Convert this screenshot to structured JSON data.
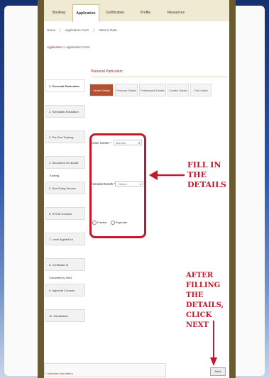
{
  "tabs": [
    "Booking",
    "Application",
    "Certification",
    "Profile",
    "Resources"
  ],
  "breadcrumb": [
    "Home",
    "Application Form",
    "Historic Data"
  ],
  "subcrumb": [
    "Application",
    "> Application Form"
  ],
  "panel": {
    "title": "Personal Particulars"
  },
  "steps": [
    "Center Details",
    "Personal Details",
    "Professional Details",
    "Contact Details",
    "Fee Details"
  ],
  "sidebar": [
    "1. Personal Particulars",
    "2. Scholastic Education",
    "3. Pre-Sea Training",
    "4. Structured On-Board Training",
    "5. Sea Going Service",
    "6. STCW Courses",
    "7. Level Applied for",
    "8. Certificate of Competency Held",
    "9. Approval Courses",
    "10. Declaration"
  ],
  "form": {
    "exam_center_label": "Exam Center *",
    "exam_center_value": "Mumbai",
    "intended_month_label": "Intended Month *",
    "intended_month_value": "- Select -",
    "radio_fresher": "Fresher",
    "radio_repeater": "Repeater"
  },
  "annotations": {
    "fill_in": "FILL IN THE DETAILS",
    "after_filling": "AFTER FILLING THE DETAILS, CLICK NEXT",
    "color": "#c21a2c"
  },
  "footer": {
    "note": "* Indicates mandatory",
    "next_label": "Next"
  }
}
